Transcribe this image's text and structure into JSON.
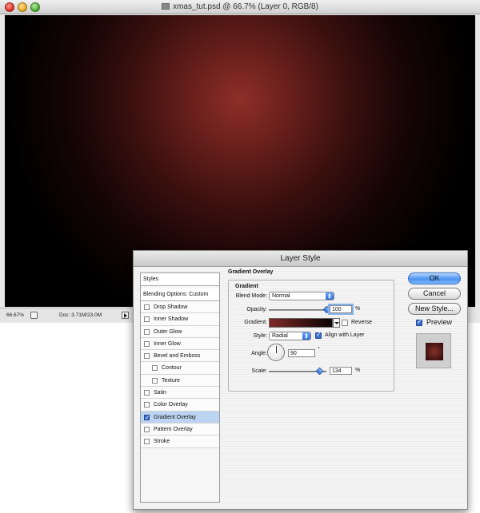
{
  "document": {
    "title": "xmas_tut.psd @ 66.7% (Layer 0, RGB/8)",
    "zoom": "66.67%",
    "doc_size": "Doc: 3.71M/23.0M"
  },
  "dialog": {
    "title": "Layer Style",
    "styles_header": "Styles",
    "blending_options": "Blending Options: Custom",
    "effects": [
      {
        "label": "Drop Shadow",
        "checked": false,
        "sub": false
      },
      {
        "label": "Inner Shadow",
        "checked": false,
        "sub": false
      },
      {
        "label": "Outer Glow",
        "checked": false,
        "sub": false
      },
      {
        "label": "Inner Glow",
        "checked": false,
        "sub": false
      },
      {
        "label": "Bevel and Emboss",
        "checked": false,
        "sub": false
      },
      {
        "label": "Contour",
        "checked": false,
        "sub": true
      },
      {
        "label": "Texture",
        "checked": false,
        "sub": true
      },
      {
        "label": "Satin",
        "checked": false,
        "sub": false
      },
      {
        "label": "Color Overlay",
        "checked": false,
        "sub": false
      },
      {
        "label": "Gradient Overlay",
        "checked": true,
        "sub": false,
        "selected": true
      },
      {
        "label": "Pattern Overlay",
        "checked": false,
        "sub": false
      },
      {
        "label": "Stroke",
        "checked": false,
        "sub": false
      }
    ],
    "panel": {
      "group_title": "Gradient Overlay",
      "subgroup_title": "Gradient",
      "blend_mode_label": "Blend Mode:",
      "blend_mode_value": "Normal",
      "opacity_label": "Opacity:",
      "opacity_value": "100",
      "opacity_unit": "%",
      "gradient_label": "Gradient:",
      "reverse_label": "Reverse",
      "style_label": "Style:",
      "style_value": "Radial",
      "align_label": "Align with Layer",
      "angle_label": "Angle:",
      "angle_value": "90",
      "angle_unit": "°",
      "scale_label": "Scale:",
      "scale_value": "134",
      "scale_unit": "%"
    },
    "buttons": {
      "ok": "OK",
      "cancel": "Cancel",
      "new_style": "New Style...",
      "preview": "Preview"
    }
  }
}
